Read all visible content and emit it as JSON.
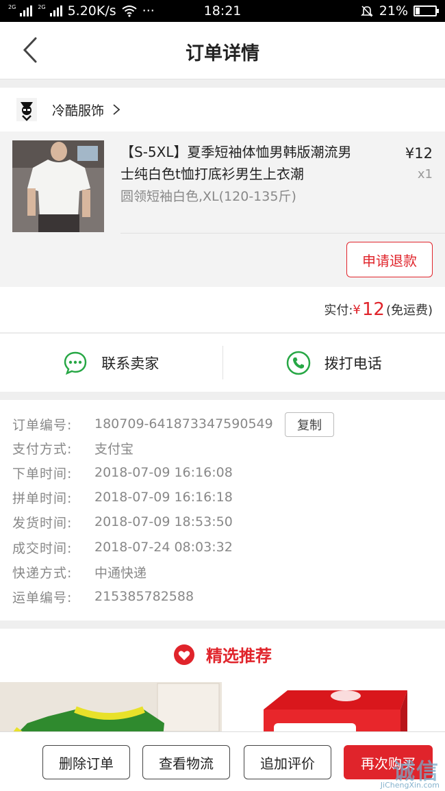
{
  "status_bar": {
    "network_tag_1": "2G",
    "network_tag_2": "2G",
    "speed": "5.20K/s",
    "dots": "···",
    "time": "18:21",
    "battery": "21%",
    "battery_level_pct": 21
  },
  "header": {
    "title": "订单详情"
  },
  "shop": {
    "name": "冷酷服饰"
  },
  "product": {
    "title": "【S-5XL】夏季短袖体恤男韩版潮流男士纯白色t恤打底衫男生上衣潮",
    "spec": "圆领短袖白色,XL(120-135斤)",
    "price": "¥12",
    "qty": "x1",
    "refund_label": "申请退款"
  },
  "total": {
    "label": "实付:",
    "currency": "¥",
    "amount": "12",
    "note": "(免运费)"
  },
  "contact": {
    "seller_label": "联系卖家",
    "phone_label": "拨打电话"
  },
  "order_info": {
    "copy_label": "复制",
    "rows": [
      {
        "label": "订单编号:",
        "value": "180709-641873347590549"
      },
      {
        "label": "支付方式:",
        "value": "支付宝"
      },
      {
        "label": "下单时间:",
        "value": "2018-07-09 16:16:08"
      },
      {
        "label": "拼单时间:",
        "value": "2018-07-09 16:16:18"
      },
      {
        "label": "发货时间:",
        "value": "2018-07-09 18:53:50"
      },
      {
        "label": "成交时间:",
        "value": "2018-07-24 08:03:32"
      },
      {
        "label": "快递方式:",
        "value": "中通快递"
      },
      {
        "label": "运单编号:",
        "value": "215385782588"
      }
    ]
  },
  "recommend": {
    "title": "精选推荐"
  },
  "actions": {
    "delete": "删除订单",
    "logistics": "查看物流",
    "review": "追加评价",
    "rebuy": "再次购买"
  },
  "watermark": {
    "main": "诚信",
    "sub": "JiChengXin.com"
  },
  "colors": {
    "accent": "#e0242b",
    "green": "#27a745"
  }
}
